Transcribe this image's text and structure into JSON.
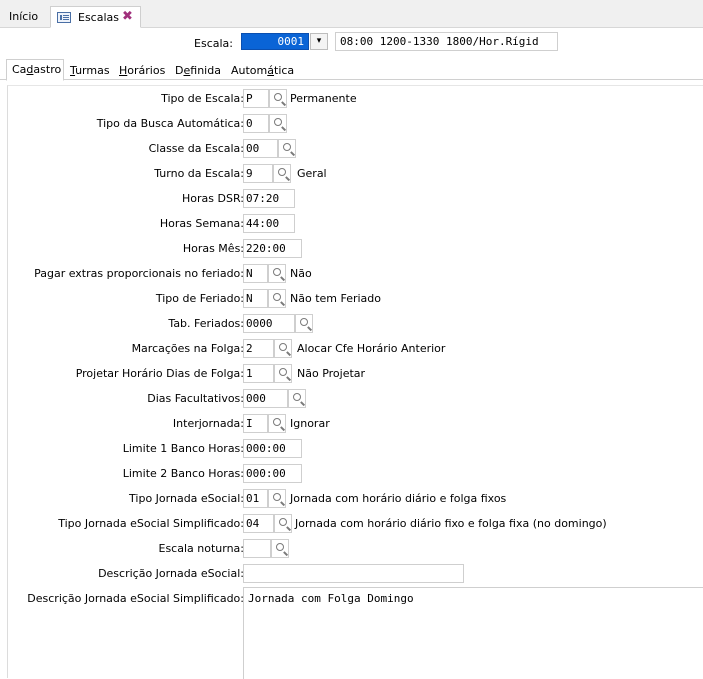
{
  "top_tabs": {
    "home": "Início",
    "active": "Escalas",
    "close": "✖"
  },
  "escala": {
    "label": "Escala:",
    "code": "0001",
    "description": "08:00 1200-1330 1800/Hor.Rígid",
    "dropdown_glyph": "▾"
  },
  "inner_tabs": [
    {
      "pre": "Ca",
      "u": "d",
      "post": "astro"
    },
    {
      "pre": "",
      "u": "T",
      "post": "urmas"
    },
    {
      "pre": "",
      "u": "H",
      "post": "orários"
    },
    {
      "pre": "D",
      "u": "e",
      "post": "finida"
    },
    {
      "pre": "Autom",
      "u": "á",
      "post": "tica"
    }
  ],
  "fields": [
    {
      "label": "Tipo de Escala:",
      "value": "P",
      "desc": "Permanente"
    },
    {
      "label": "Tipo da Busca Automática:",
      "value": "0",
      "desc": ""
    },
    {
      "label": "Classe da Escala:",
      "value": "00",
      "desc": ""
    },
    {
      "label": "Turno da Escala:",
      "value": "9",
      "desc": "Geral"
    },
    {
      "label": "Horas DSR:",
      "value": "07:20",
      "desc": ""
    },
    {
      "label": "Horas Semana:",
      "value": "44:00",
      "desc": ""
    },
    {
      "label": "Horas Mês:",
      "value": "220:00",
      "desc": ""
    },
    {
      "label": "Pagar extras proporcionais no feriado:",
      "value": "N",
      "desc": "Não"
    },
    {
      "label": "Tipo de Feriado:",
      "value": "N",
      "desc": "Não tem Feriado"
    },
    {
      "label": "Tab. Feriados:",
      "value": "0000",
      "desc": ""
    },
    {
      "label": "Marcações na Folga:",
      "value": "2",
      "desc": "Alocar Cfe Horário Anterior"
    },
    {
      "label": "Projetar Horário Dias de Folga:",
      "value": "1",
      "desc": "Não Projetar"
    },
    {
      "label": "Dias Facultativos:",
      "value": "000",
      "desc": ""
    },
    {
      "label": "Interjornada:",
      "value": "I",
      "desc": "Ignorar"
    },
    {
      "label": "Limite 1 Banco Horas:",
      "value": "000:00",
      "desc": ""
    },
    {
      "label": "Limite 2 Banco Horas:",
      "value": "000:00",
      "desc": ""
    },
    {
      "label": "Tipo Jornada eSocial:",
      "value": "01",
      "desc": "Jornada com horário diário e folga fixos"
    },
    {
      "label": "Tipo Jornada eSocial Simplificado:",
      "value": "04",
      "desc": "Jornada com horário diário fixo e folga fixa (no domingo)"
    },
    {
      "label": "Escala noturna:",
      "value": "",
      "desc": ""
    },
    {
      "label": "Descrição Jornada eSocial:",
      "value": "",
      "desc": ""
    },
    {
      "label": "Descrição Jornada eSocial Simplificado:",
      "value": "Jornada com Folga Domingo",
      "desc": ""
    }
  ]
}
